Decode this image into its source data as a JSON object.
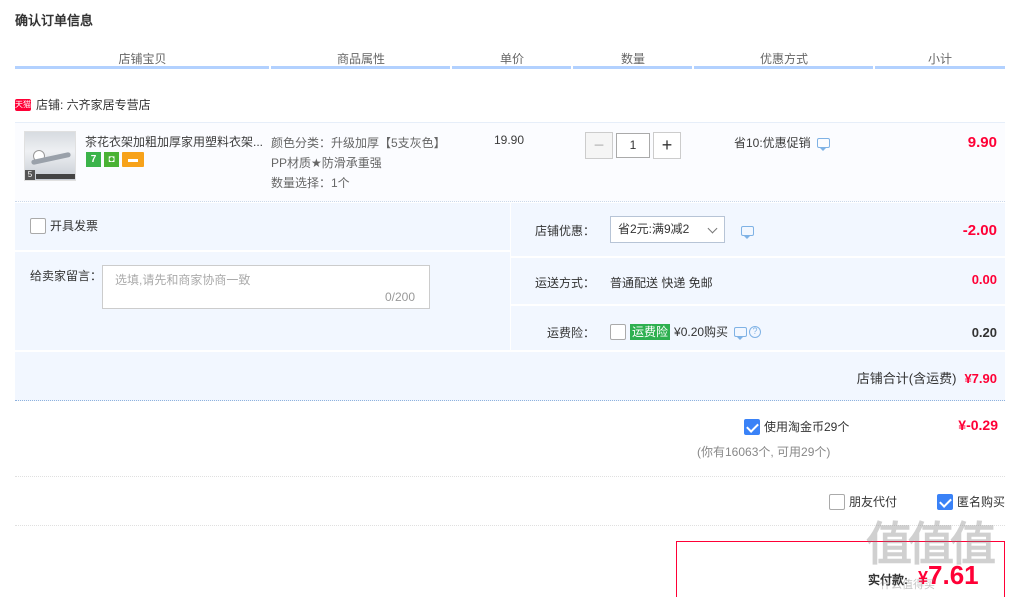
{
  "page_title": "确认订单信息",
  "columns": [
    "店铺宝贝",
    "商品属性",
    "单价",
    "数量",
    "优惠方式",
    "小计"
  ],
  "shop": {
    "badge": "天猫",
    "name_label": "店铺: 六齐家居专营店"
  },
  "item": {
    "title": "茶花衣架加粗加厚家用塑料衣架...",
    "thumb_tag": "5",
    "attrs": [
      "颜色分类：升级加厚【5支灰色】",
      "PP材质★防滑承重强",
      "数量选择：1个"
    ],
    "price": "19.90",
    "quantity": "1",
    "qty_minus": "−",
    "qty_plus": "+",
    "promo": "省10:优惠促销",
    "subtotal": "9.90",
    "badge_seven": "7"
  },
  "invoice": {
    "label": "开具发票",
    "checked": false
  },
  "message": {
    "label": "给卖家留言：",
    "placeholder": "选填,请先和商家协商一致",
    "count": "0/200"
  },
  "shop_coupon": {
    "label": "店铺优惠：",
    "selected": "省2元:满9减2",
    "amount": "-2.00"
  },
  "shipping": {
    "label": "运送方式：",
    "value": "普通配送 快递 免邮",
    "amount": "0.00"
  },
  "insurance": {
    "label": "运费险：",
    "tag": "运费险",
    "text": "¥0.20购买",
    "amount": "0.20",
    "checked": false
  },
  "shop_total": {
    "label": "店铺合计(含运费)",
    "amount": "¥7.90"
  },
  "coins": {
    "label": "使用淘金币29个",
    "checked": true,
    "amount": "¥-0.29",
    "note": "(你有16063个, 可用29个)"
  },
  "friend_pay": {
    "label": "朋友代付",
    "checked": false
  },
  "anonymous": {
    "label": "匿名购买",
    "checked": true
  },
  "payment": {
    "label": "实付款:",
    "currency": "¥",
    "amount": "7.61"
  },
  "watermark": {
    "text": "值值值",
    "sub": "什么值得买"
  }
}
